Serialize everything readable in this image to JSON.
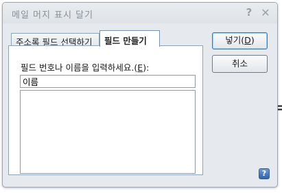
{
  "window": {
    "title": "메일 머지 표시 달기",
    "help_glyph": "?",
    "close_glyph": "✕"
  },
  "tabs": [
    {
      "label": "주소록 필드 선택하기",
      "active": false
    },
    {
      "label": "필드 만들기",
      "active": true
    }
  ],
  "field": {
    "label_prefix": "필드 번호나 이름을 입력하세요.(",
    "label_key": "E",
    "label_suffix": "):",
    "value": "이름"
  },
  "buttons": {
    "insert_prefix": "넣기(",
    "insert_key": "D",
    "insert_suffix": ")",
    "cancel": "취소"
  },
  "help_icon_glyph": "?",
  "background": {
    "glyph1": "(",
    "glyph2": "=",
    "glyph3": "("
  }
}
